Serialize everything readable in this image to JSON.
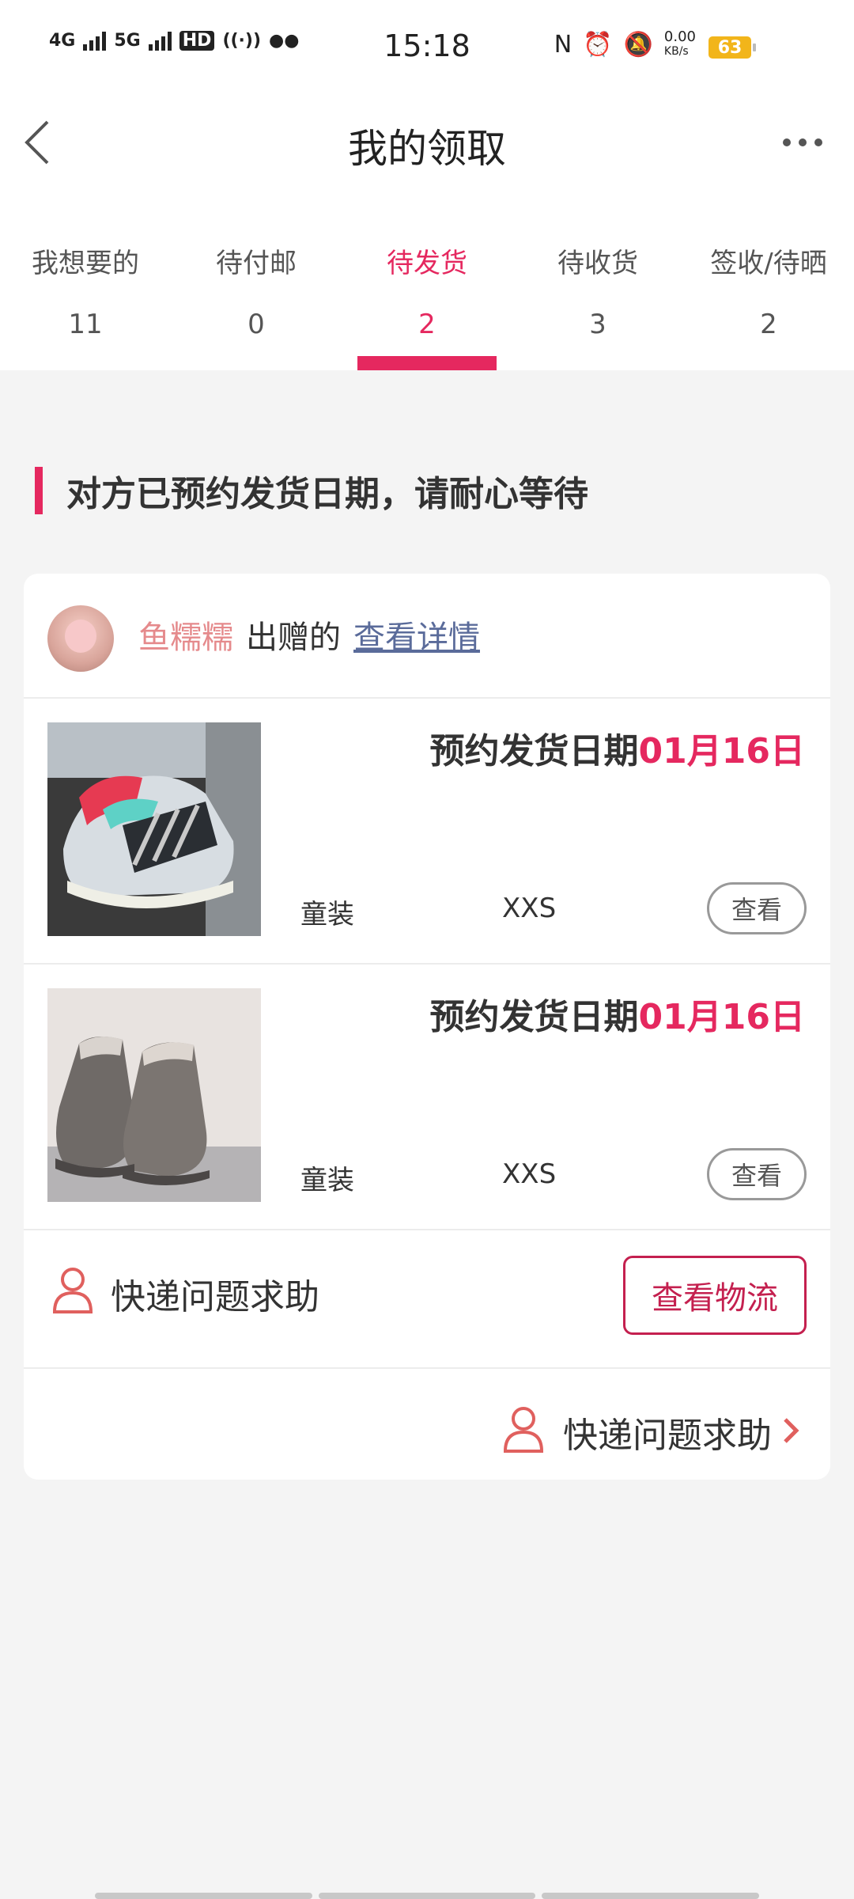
{
  "status_bar": {
    "network_left": "4G",
    "network_right": "5G",
    "hd_label": "HD",
    "time": "15:18",
    "data_rate": "0.00",
    "data_rate_unit": "KB/s",
    "battery": "63"
  },
  "header": {
    "title": "我的领取"
  },
  "tabs": [
    {
      "label": "我想要的",
      "count": "11"
    },
    {
      "label": "待付邮",
      "count": "0"
    },
    {
      "label": "待发货",
      "count": "2"
    },
    {
      "label": "待收货",
      "count": "3"
    },
    {
      "label": "签收/待晒",
      "count": "2"
    }
  ],
  "active_tab": 2,
  "notice": "对方已预约发货日期，请耐心等待",
  "donor": {
    "name": "鱼糯糯",
    "suffix": "出赠的",
    "link": "查看详情"
  },
  "items": [
    {
      "date_label": "预约发货日期",
      "date": "01月16日",
      "category": "童装",
      "size": "XXS",
      "button": "查看"
    },
    {
      "date_label": "预约发货日期",
      "date": "01月16日",
      "category": "童装",
      "size": "XXS",
      "button": "查看"
    }
  ],
  "help": {
    "label": "快递问题求助",
    "logistics_button": "查看物流",
    "bottom_label": "快递问题求助"
  },
  "colors": {
    "accent": "#e5285f",
    "donor_name": "#e58a8c",
    "link": "#5a6b9a"
  }
}
